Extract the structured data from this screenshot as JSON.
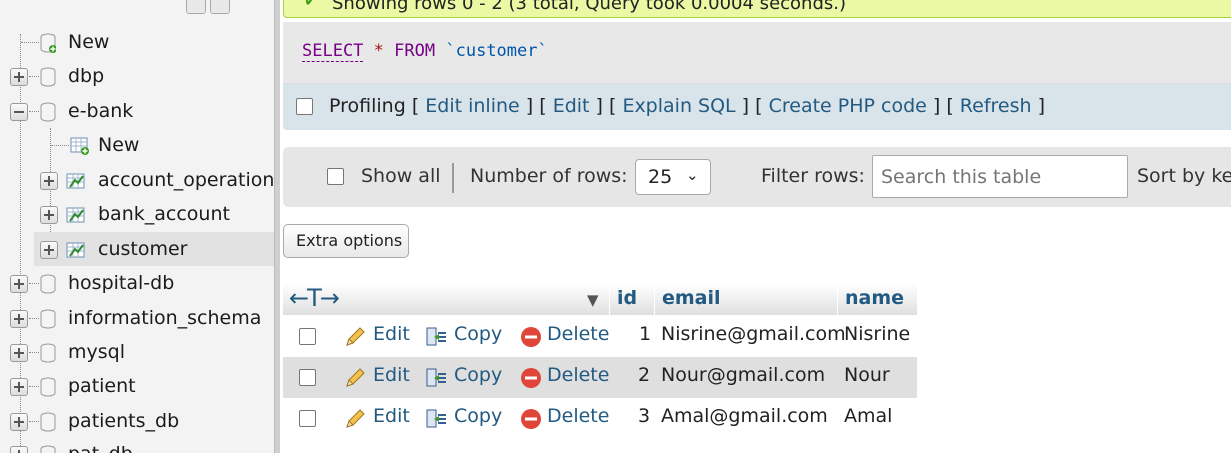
{
  "sidebar": {
    "items": [
      {
        "label": "New",
        "kind": "new"
      },
      {
        "label": "dbp",
        "kind": "db"
      },
      {
        "label": "e-bank",
        "kind": "db-open"
      },
      {
        "label": "New",
        "kind": "new-child"
      },
      {
        "label": "account_operation",
        "kind": "table"
      },
      {
        "label": "bank_account",
        "kind": "table"
      },
      {
        "label": "customer",
        "kind": "table-selected"
      },
      {
        "label": "hospital-db",
        "kind": "db"
      },
      {
        "label": "information_schema",
        "kind": "db"
      },
      {
        "label": "mysql",
        "kind": "db"
      },
      {
        "label": "patient",
        "kind": "db"
      },
      {
        "label": "patients_db",
        "kind": "db"
      },
      {
        "label": "pat_db",
        "kind": "db"
      }
    ]
  },
  "success": {
    "text": "Showing rows 0 - 2 (3 total, Query took 0.0004 seconds.)"
  },
  "sql": {
    "select": "SELECT",
    "star": "*",
    "from": "FROM",
    "table": "`customer`"
  },
  "profiling": {
    "label": "Profiling",
    "links": [
      "Edit inline",
      "Edit",
      "Explain SQL",
      "Create PHP code",
      "Refresh"
    ]
  },
  "navigation": {
    "show_all": "Show all",
    "rows_label": "Number of rows:",
    "rows_value": "25",
    "filter_label": "Filter rows:",
    "filter_placeholder": "Search this table",
    "sort_label": "Sort by key"
  },
  "extra_options": "Extra options",
  "table": {
    "columns": [
      "id",
      "email",
      "name"
    ],
    "actions": {
      "edit": "Edit",
      "copy": "Copy",
      "delete": "Delete"
    },
    "rows": [
      {
        "id": "1",
        "email": "Nisrine@gmail.com",
        "name": "Nisrine"
      },
      {
        "id": "2",
        "email": "Nour@gmail.com",
        "name": "Nour"
      },
      {
        "id": "3",
        "email": "Amal@gmail.com",
        "name": "Amal"
      }
    ]
  },
  "colors": {
    "link": "#235a81",
    "success_bg": "#ebf8a4",
    "profiling_bg": "#d9e3ea",
    "row_stripe": "#dfdfdf"
  }
}
